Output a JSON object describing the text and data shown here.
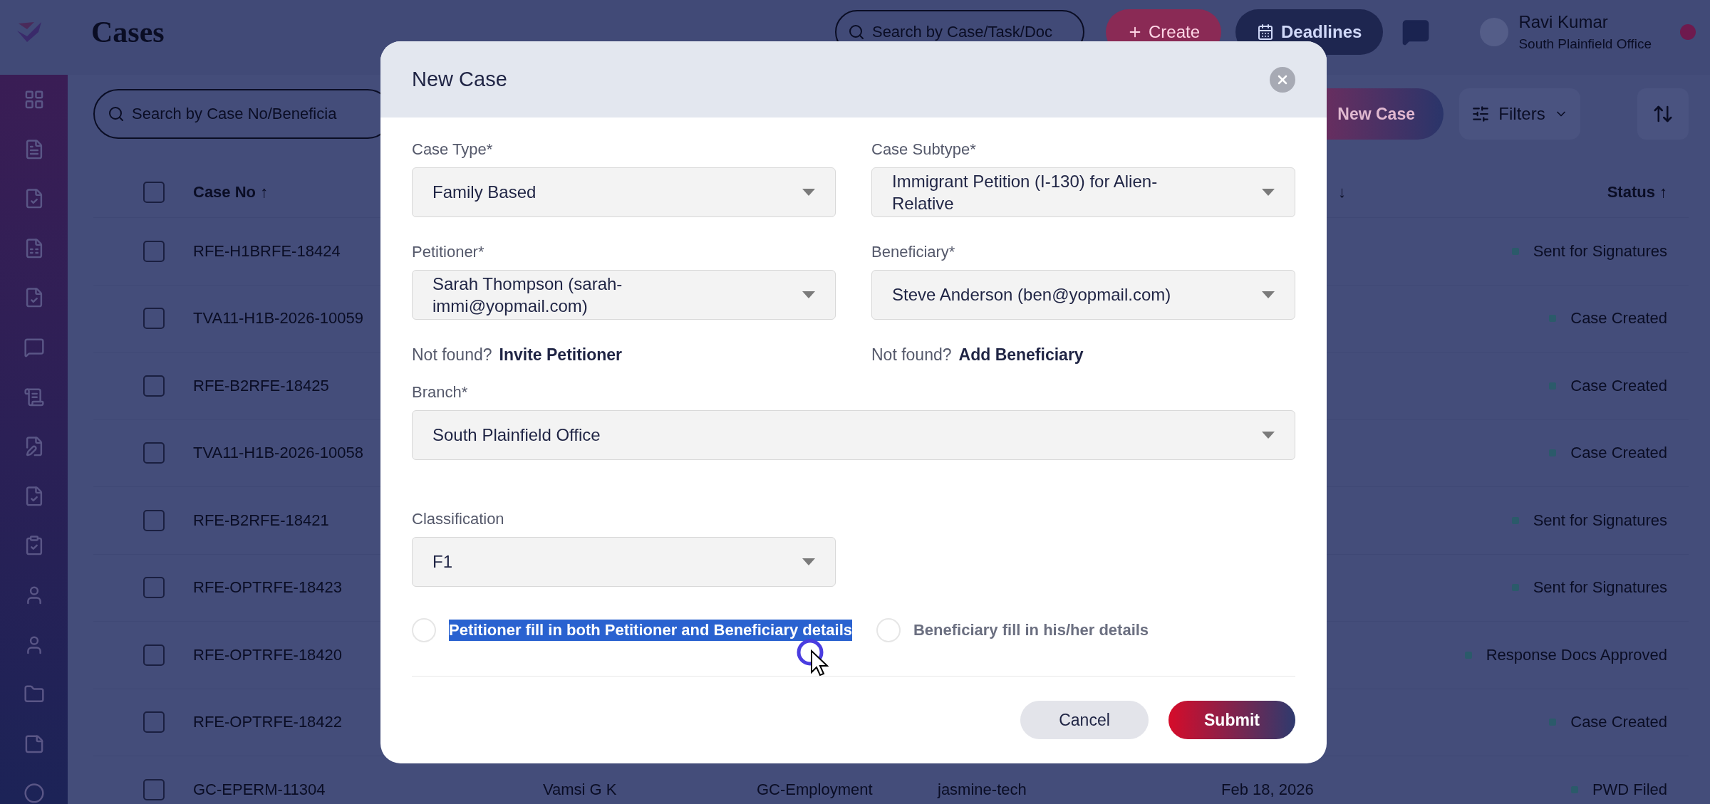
{
  "header": {
    "title": "Cases",
    "search": {
      "placeholder": "Search by Case/Task/Doc"
    },
    "create_button": "Create",
    "deadlines_button": "Deadlines",
    "user": {
      "name": "Ravi Kumar",
      "office": "South Plainfield Office"
    }
  },
  "sidebar": {
    "items": [
      {
        "kind": "grid"
      },
      {
        "kind": "doc"
      },
      {
        "kind": "doc-check"
      },
      {
        "kind": "doc-money"
      },
      {
        "kind": "doc-check"
      },
      {
        "kind": "chat"
      },
      {
        "kind": "scroll"
      },
      {
        "kind": "edit"
      },
      {
        "kind": "doc-check"
      },
      {
        "kind": "clipboard"
      },
      {
        "kind": "user"
      },
      {
        "kind": "user"
      },
      {
        "kind": "folder"
      },
      {
        "kind": "note"
      },
      {
        "kind": "circle"
      }
    ]
  },
  "toolbar": {
    "search": {
      "placeholder": "Search by Case No/Beneficia"
    },
    "new_case_button": "New Case",
    "filters_button": "Filters"
  },
  "table": {
    "columns": [
      "Case No ↑",
      "↓",
      "Status ↑"
    ],
    "all_checked": false,
    "rows": [
      {
        "case_no": "RFE-H1BRFE-18424",
        "status": "Sent for Signatures",
        "checked": false
      },
      {
        "case_no": "TVA11-H1B-2026-10059",
        "status": "Case Created",
        "checked": false
      },
      {
        "case_no": "RFE-B2RFE-18425",
        "status": "Case Created",
        "checked": false
      },
      {
        "case_no": "TVA11-H1B-2026-10058",
        "status": "Case Created",
        "checked": false
      },
      {
        "case_no": "RFE-B2RFE-18421",
        "status": "Sent for Signatures",
        "checked": false
      },
      {
        "case_no": "RFE-OPTRFE-18423",
        "status": "Sent for Signatures",
        "checked": false
      },
      {
        "case_no": "RFE-OPTRFE-18420",
        "status": "Response Docs Approved",
        "checked": false
      },
      {
        "case_no": "RFE-OPTRFE-18422",
        "status": "Case Created",
        "checked": false
      },
      {
        "case_no": "GC-EPERM-11304",
        "beneficiary": "Vamsi G K",
        "type": "GC-Employment",
        "company": "jasmine-tech",
        "date": "Feb 18, 2026",
        "status": "PWD Filed",
        "checked": false
      }
    ]
  },
  "dialog": {
    "title": "New Case",
    "fields": [
      {
        "label": "Case Type*",
        "value": "Family Based"
      },
      {
        "label": "Case Subtype*",
        "value": "Immigrant Petition (I-130) for Alien-Relative"
      },
      {
        "label": "Petitioner*",
        "value": "Sarah Thompson (sarah-immi@yopmail.com)"
      },
      {
        "label": "Beneficiary*",
        "value": "Steve Anderson (ben@yopmail.com)"
      }
    ],
    "not_found": [
      {
        "prefix": "Not found?",
        "link": "Invite Petitioner"
      },
      {
        "prefix": "Not found?",
        "link": "Add Beneficiary"
      }
    ],
    "branch": {
      "label": "Branch*",
      "value": "South Plainfield Office"
    },
    "classification": {
      "label": "Classification",
      "value": "F1"
    },
    "options": [
      {
        "label": "Petitioner fill in both Petitioner and Beneficiary details",
        "selected": false,
        "highlighted": true
      },
      {
        "label": "Beneficiary fill in his/her details",
        "selected": false,
        "highlighted": false
      }
    ],
    "buttons": {
      "cancel": "Cancel",
      "submit": "Submit"
    }
  }
}
